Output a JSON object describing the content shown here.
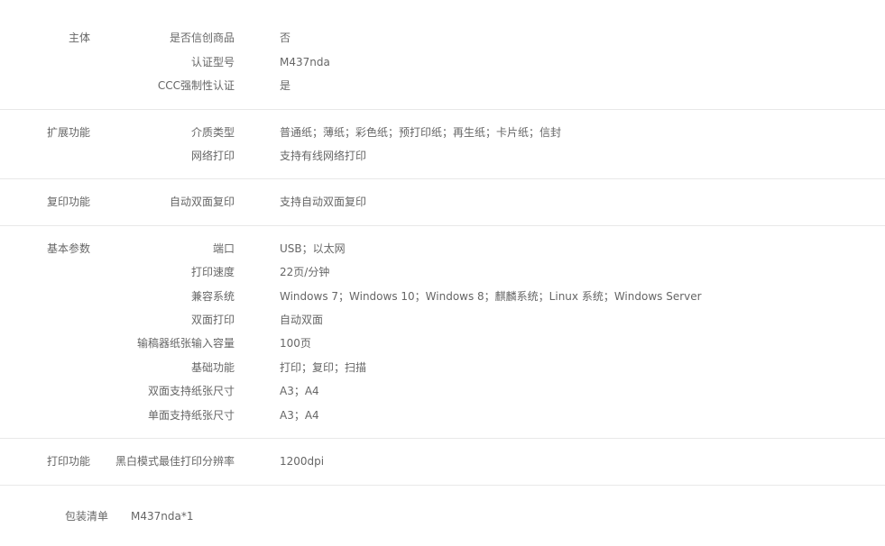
{
  "groups": [
    {
      "title": "主体",
      "rows": [
        {
          "label": "是否信创商品",
          "value": "否"
        },
        {
          "label": "认证型号",
          "value": "M437nda"
        },
        {
          "label": "CCC强制性认证",
          "value": "是"
        }
      ]
    },
    {
      "title": "扩展功能",
      "rows": [
        {
          "label": "介质类型",
          "value": "普通纸；薄纸；彩色纸；预打印纸；再生纸；卡片纸；信封"
        },
        {
          "label": "网络打印",
          "value": "支持有线网络打印"
        }
      ]
    },
    {
      "title": "复印功能",
      "rows": [
        {
          "label": "自动双面复印",
          "value": "支持自动双面复印"
        }
      ]
    },
    {
      "title": "基本参数",
      "rows": [
        {
          "label": "端口",
          "value": "USB；以太网"
        },
        {
          "label": "打印速度",
          "value": "22页/分钟"
        },
        {
          "label": "兼容系统",
          "value": "Windows 7；Windows 10；Windows 8；麒麟系统；Linux 系统；Windows Server"
        },
        {
          "label": "双面打印",
          "value": "自动双面"
        },
        {
          "label": "输稿器纸张输入容量",
          "value": "100页"
        },
        {
          "label": "基础功能",
          "value": "打印；复印；扫描"
        },
        {
          "label": "双面支持纸张尺寸",
          "value": "A3；A4"
        },
        {
          "label": "单面支持纸张尺寸",
          "value": "A3；A4"
        }
      ]
    },
    {
      "title": "打印功能",
      "rows": [
        {
          "label": "黑白模式最佳打印分辨率",
          "value": "1200dpi"
        }
      ]
    }
  ],
  "package": {
    "label": "包装清单",
    "value": "M437nda*1"
  }
}
